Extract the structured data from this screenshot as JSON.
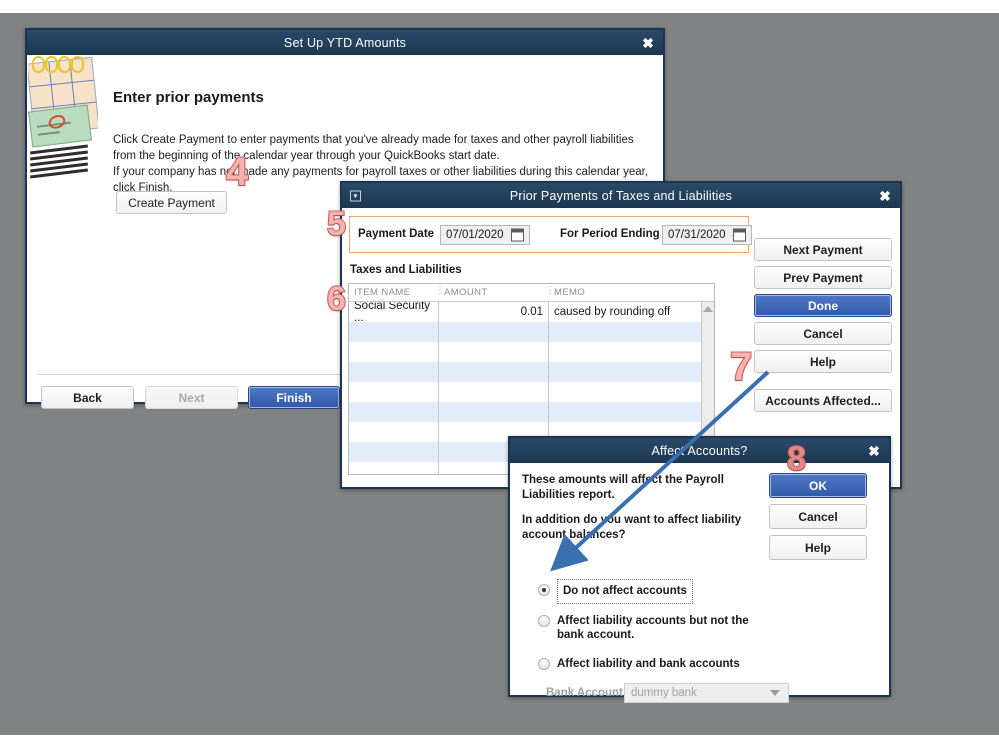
{
  "windows": {
    "ytd": {
      "title": "Set Up YTD Amounts",
      "close_icon": "✖",
      "heading": "Enter prior payments",
      "paragraph": "Click Create Payment to enter payments that you've already made for taxes and other payroll liabilities from the beginning of the calendar year through your QuickBooks start date.\nIf your company has not made any payments for payroll taxes or other liabilities during this calendar year, click Finish.",
      "create_payment_label": "Create Payment",
      "back_label": "Back",
      "next_label": "Next",
      "finish_label": "Finish"
    },
    "prior": {
      "title": "Prior Payments of Taxes and Liabilities",
      "close_icon": "✖",
      "menu_icon": "▾",
      "payment_date_label": "Payment Date",
      "payment_date_value": "07/01/2020",
      "period_ending_label": "For Period Ending",
      "period_ending_value": "07/31/2020",
      "section_heading": "Taxes and Liabilities",
      "columns": [
        "ITEM NAME",
        "AMOUNT",
        "MEMO"
      ],
      "rows": [
        {
          "item": "Social Security ...",
          "amount": "0.01",
          "memo": "caused by rounding off"
        }
      ],
      "buttons": {
        "next_payment": "Next Payment",
        "prev_payment": "Prev Payment",
        "done": "Done",
        "cancel": "Cancel",
        "help": "Help",
        "accounts_affected": "Accounts Affected..."
      }
    },
    "affect": {
      "title": "Affect Accounts?",
      "close_icon": "✖",
      "text1": "These amounts will affect the Payroll Liabilities report.",
      "text2": "In addition do you want to affect liability account balances?",
      "options": [
        "Do not affect accounts",
        "Affect liability accounts but not the bank account.",
        "Affect liability and bank accounts"
      ],
      "selected_option_index": 0,
      "bank_account_label": "Bank Account",
      "bank_account_value": "dummy bank",
      "buttons": {
        "ok": "OK",
        "cancel": "Cancel",
        "help": "Help"
      }
    }
  },
  "annotations": {
    "step4": "4",
    "step5": "5",
    "step6": "6",
    "step7": "7",
    "step8": "8",
    "arrow_color": "#3a6fb0"
  },
  "colors": {
    "titlebar": "#23415f",
    "primary_button": "#3158ab",
    "page_background": "#808284",
    "highlight_border": "#f0a868",
    "row_stripe": "#e3edf9",
    "annotation": "#d9615c"
  }
}
